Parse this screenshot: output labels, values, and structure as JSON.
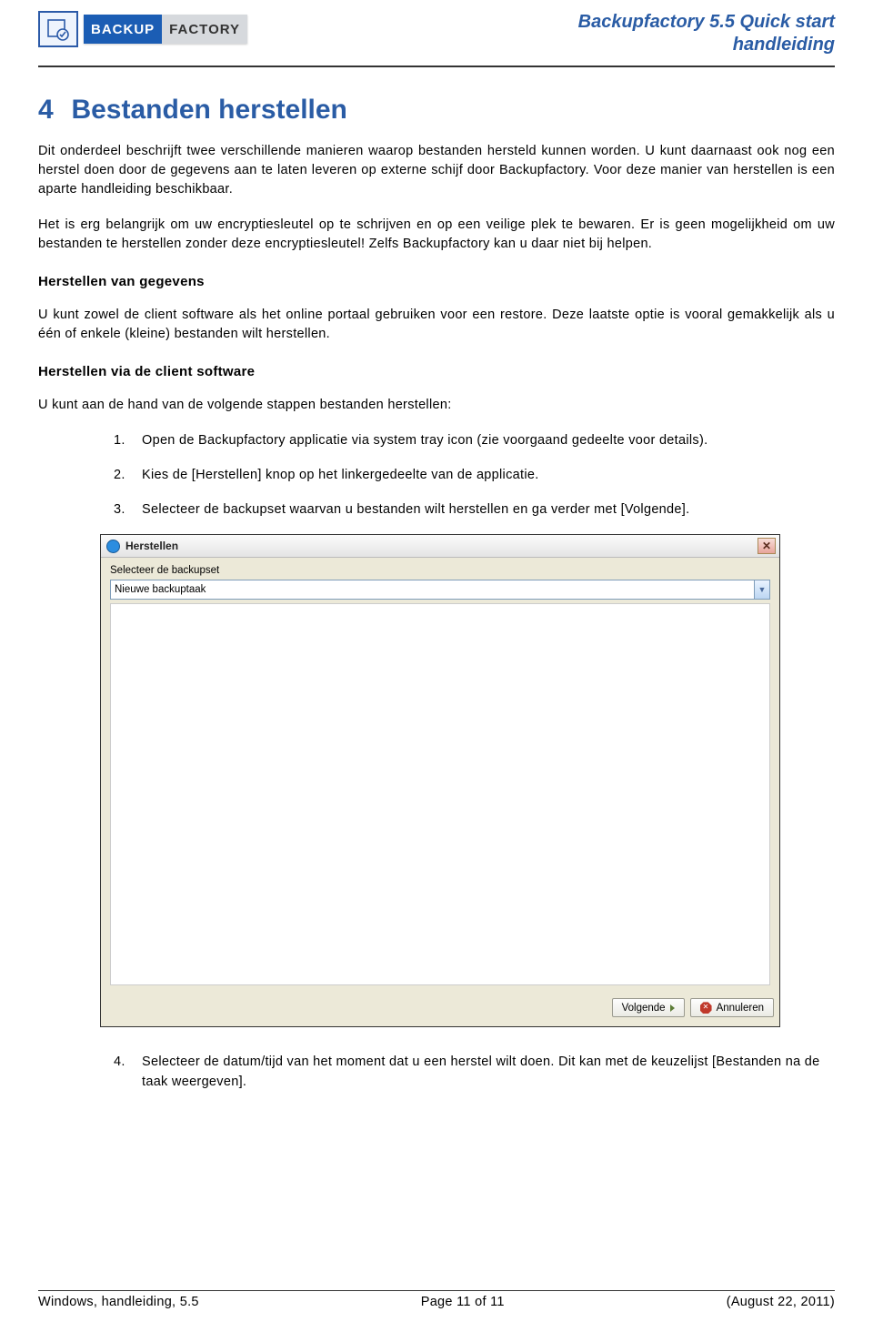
{
  "header": {
    "logo_left": "BACKUP",
    "logo_right": "FACTORY",
    "doc_title_line1": "Backupfactory 5.5 Quick start",
    "doc_title_line2": "handleiding"
  },
  "section": {
    "number": "4",
    "title": "Bestanden herstellen"
  },
  "paras": {
    "p1": "Dit onderdeel beschrijft twee verschillende manieren waarop bestanden hersteld kunnen worden. U kunt daarnaast ook nog een herstel doen door de gegevens aan te laten leveren op externe schijf door Backupfactory. Voor deze manier van herstellen is een aparte handleiding beschikbaar.",
    "p2": "Het is erg belangrijk om uw encryptiesleutel op te schrijven en op een veilige plek te bewaren. Er is geen mogelijkheid om uw bestanden te herstellen zonder deze encryptiesleutel! Zelfs Backupfactory kan u daar niet bij helpen.",
    "sub1": "Herstellen van gegevens",
    "p3": "U kunt zowel de client software als het online portaal gebruiken voor een restore. Deze laatste optie is vooral gemakkelijk als u één of enkele (kleine) bestanden wilt herstellen.",
    "sub2": "Herstellen via de client software",
    "p4": "U kunt aan de hand van de volgende stappen bestanden herstellen:"
  },
  "steps_a": [
    "Open de Backupfactory applicatie via system tray icon (zie voorgaand gedeelte voor details).",
    "Kies de [Herstellen] knop op het linkergedeelte van de applicatie.",
    "Selecteer de backupset waarvan u bestanden wilt herstellen en ga verder met [Volgende]."
  ],
  "dialog": {
    "title": "Herstellen",
    "label": "Selecteer de backupset",
    "selected": "Nieuwe backuptaak",
    "btn_next": "Volgende",
    "btn_cancel": "Annuleren"
  },
  "steps_b": [
    "Selecteer de datum/tijd van het moment dat u een herstel wilt doen. Dit kan met de keuzelijst [Bestanden na de taak weergeven]."
  ],
  "footer": {
    "left": "Windows, handleiding, 5.5",
    "center": "Page 11 of 11",
    "right": "(August 22, 2011)"
  }
}
